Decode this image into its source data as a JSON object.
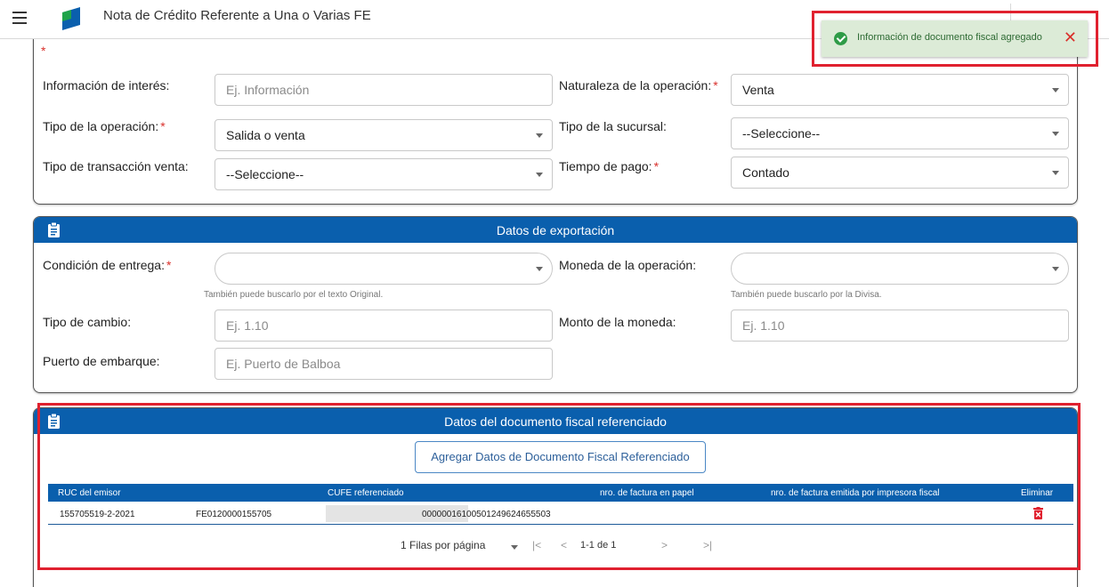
{
  "app": {
    "title": "Nota de Crédito Referente a Una o Varias FE"
  },
  "toast": {
    "message": "Información de documento fiscal agregado",
    "close": "✕"
  },
  "general": {
    "required_mark": "*",
    "info_label": "Información de interés:",
    "info_placeholder": "Ej. Información",
    "naturaleza_label": "Naturaleza de la operación:",
    "naturaleza_value": "Venta",
    "tipo_op_label": "Tipo de la operación:",
    "tipo_op_value": "Salida o venta",
    "sucursal_label": "Tipo de la sucursal:",
    "sucursal_value": "--Seleccione--",
    "transaccion_label": "Tipo de transacción venta:",
    "transaccion_value": "--Seleccione--",
    "pago_label": "Tiempo de pago:",
    "pago_value": "Contado"
  },
  "export": {
    "title": "Datos de exportación",
    "condicion_label": "Condición de entrega:",
    "condicion_hint": "También puede buscarlo por el texto Original.",
    "moneda_label": "Moneda de la operación:",
    "moneda_hint": "También puede buscarlo por la Divisa.",
    "cambio_label": "Tipo de cambio:",
    "cambio_placeholder": "Ej. 1.10",
    "monto_label": "Monto de la moneda:",
    "monto_placeholder": "Ej. 1.10",
    "puerto_label": "Puerto de embarque:",
    "puerto_placeholder": "Ej. Puerto de Balboa"
  },
  "ref": {
    "title": "Datos del documento fiscal referenciado",
    "add_button": "Agregar Datos de Documento Fiscal Referenciado",
    "columns": [
      "RUC del emisor",
      "CUFE referenciado",
      "nro. de factura en papel",
      "nro. de factura emitida por impresora fiscal",
      "Eliminar"
    ],
    "row": {
      "ruc": "155705519-2-2021",
      "cufe_start": "FE0120000155705",
      "cufe_end": "00000016100501249624655503"
    },
    "pager": {
      "rows_label": "1 Filas por página",
      "first": "|<",
      "prev": "<",
      "range": "1-1 de 1",
      "next": ">",
      "last": ">|"
    }
  },
  "colors": {
    "header_blue": "#0a5fad",
    "highlight_red": "#e0212f",
    "toast_bg": "#dcebd7",
    "required_red": "#d9302b"
  },
  "icons": [
    "menu-icon",
    "app-logo-icon",
    "check-circle-icon",
    "close-icon",
    "clipboard-icon",
    "trash-icon",
    "caret-down-icon"
  ]
}
